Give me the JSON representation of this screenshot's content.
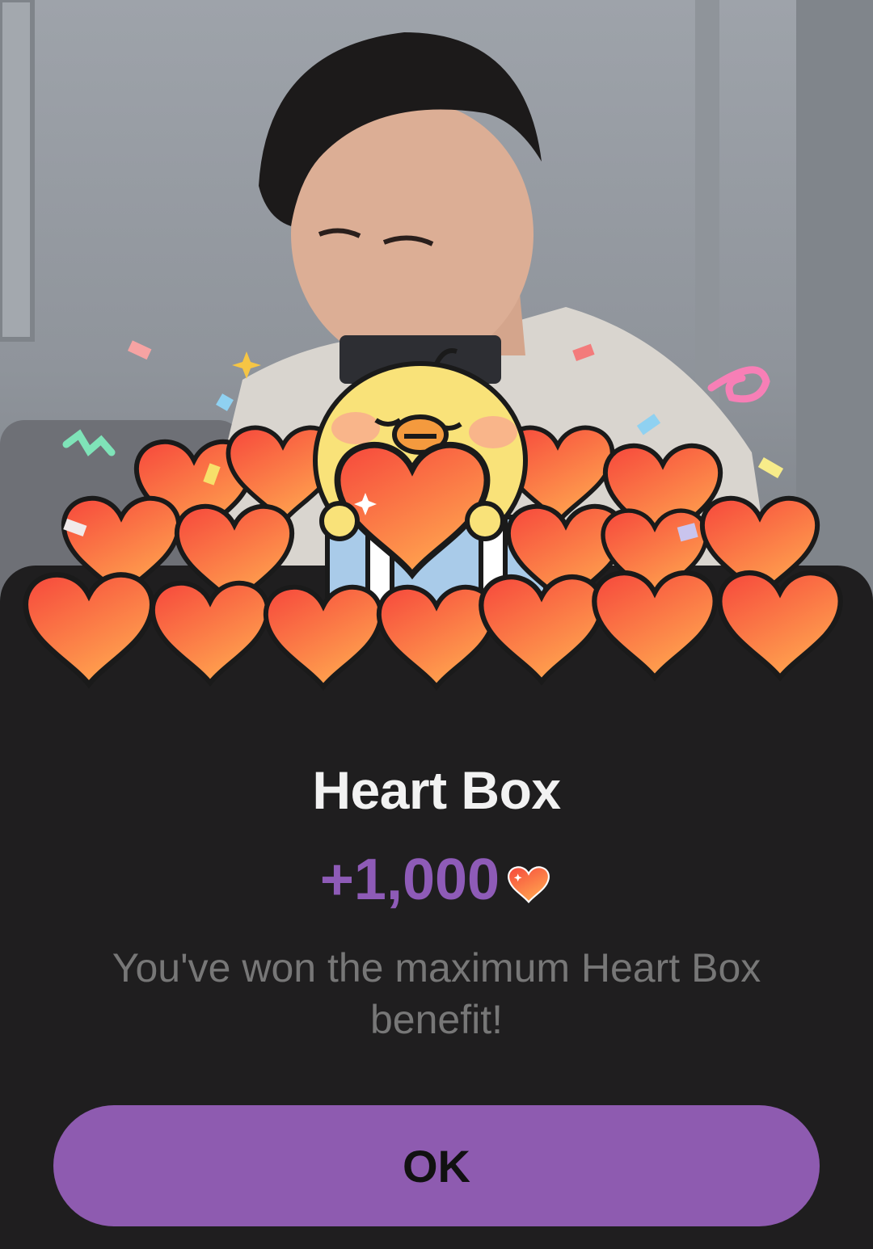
{
  "dialog": {
    "title": "Heart Box",
    "reward_amount": "+1,000",
    "reward_icon": "heart-icon",
    "message": "You've won the maximum Heart Box benefit!",
    "ok_label": "OK"
  },
  "colors": {
    "accent": "#8e5bb0",
    "sheet_background": "#1f1e1f",
    "heart": "#f5563a"
  }
}
